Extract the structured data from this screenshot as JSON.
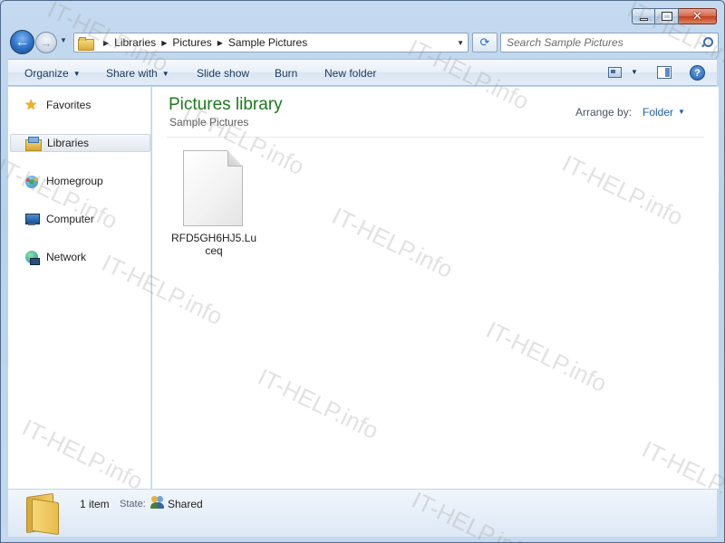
{
  "window": {
    "caption_buttons": {
      "minimize_icon": "minimize-icon",
      "maximize_icon": "restore-icon",
      "close_glyph": "✕"
    }
  },
  "navigation": {
    "back_glyph": "←",
    "forward_glyph": "→",
    "recent_glyph": "▼",
    "breadcrumbs": [
      "Libraries",
      "Pictures",
      "Sample Pictures"
    ],
    "refresh_glyph": "⟳",
    "search_placeholder": "Search Sample Pictures"
  },
  "toolbar": {
    "organize": "Organize",
    "share_with": "Share with",
    "slide_show": "Slide show",
    "burn": "Burn",
    "new_folder": "New folder",
    "help": "?"
  },
  "nav_pane": {
    "items": [
      {
        "label": "Favorites",
        "icon": "star-icon",
        "glyph": "★"
      },
      {
        "label": "Libraries",
        "icon": "libraries-icon",
        "selected": true
      },
      {
        "label": "Homegroup",
        "icon": "homegroup-icon"
      },
      {
        "label": "Computer",
        "icon": "computer-icon"
      },
      {
        "label": "Network",
        "icon": "network-icon"
      }
    ]
  },
  "content": {
    "library_title": "Pictures library",
    "library_subtitle": "Sample Pictures",
    "arrange_by_label": "Arrange by:",
    "arrange_by_value": "Folder",
    "files": [
      {
        "name": "RFD5GH6HJ5.Luceq",
        "icon": "generic-file-icon"
      }
    ]
  },
  "details_pane": {
    "item_count": "1 item",
    "state_label": "State:",
    "state_value": "Shared"
  },
  "watermark": {
    "text": "IT-HELP.info"
  },
  "colors": {
    "library_title": "#1d7a1d",
    "link_blue": "#1f5fae",
    "frame": "#bcd3ea"
  }
}
